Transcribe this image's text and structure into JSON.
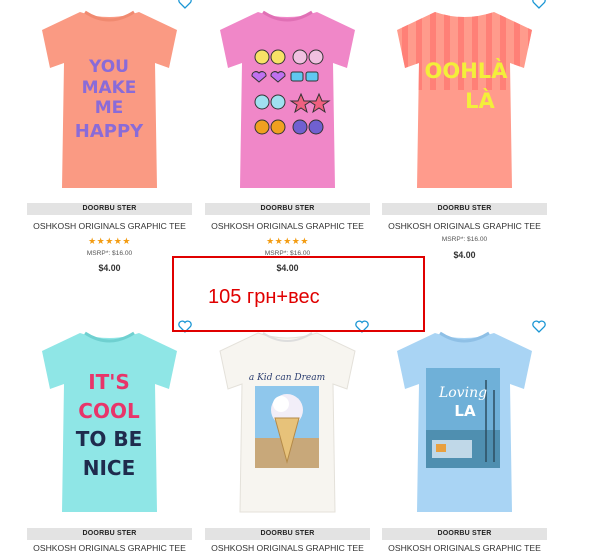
{
  "products": [
    {
      "badge": "DOORBU STER",
      "title": "OSHKOSH ORIGINALS GRAPHIC TEE",
      "stars": "★★★★★",
      "msrp": "MSRP*: $16.00",
      "price": "$4.00",
      "shirt_color": "#fa9a83",
      "print": [
        "YOU",
        "MAKE",
        "ME",
        "HAPPY"
      ]
    },
    {
      "badge": "DOORBU STER",
      "title": "OSHKOSH ORIGINALS GRAPHIC TEE",
      "stars": "★★★★★",
      "msrp": "MSRP*: $16.00",
      "price": "$4.00",
      "shirt_color": "#f087c8",
      "print": []
    },
    {
      "badge": "DOORBU STER",
      "title": "OSHKOSH ORIGINALS GRAPHIC TEE",
      "stars": "",
      "msrp": "MSRP*: $16.00",
      "price": "$4.00",
      "shirt_color": "#ff9b8c",
      "print": [
        "OOHLÀ",
        "LÀ"
      ]
    },
    {
      "badge": "DOORBU STER",
      "title": "OSHKOSH ORIGINALS GRAPHIC TEE",
      "shirt_color": "#8fe6e6",
      "print": [
        "IT'S",
        "COOL",
        "TO BE",
        "NICE"
      ]
    },
    {
      "badge": "DOORBU STER",
      "title": "OSHKOSH ORIGINALS GRAPHIC TEE",
      "shirt_color": "#f7f5f0",
      "print": [
        "a Kid can Dream"
      ]
    },
    {
      "badge": "DOORBU STER",
      "title": "OSHKOSH ORIGINALS GRAPHIC TEE",
      "shirt_color": "#a9d4f4",
      "print": [
        "Loving",
        "LA"
      ]
    }
  ],
  "annotation": "105 грн+вес",
  "colors": {
    "accent": "#f39c12",
    "annotation": "#e00000",
    "wishlist": "#1a96d4",
    "badge_bg": "#e3e3e3"
  },
  "icons": {
    "wishlist": "heart-outline-icon",
    "rating": "star-icon"
  }
}
